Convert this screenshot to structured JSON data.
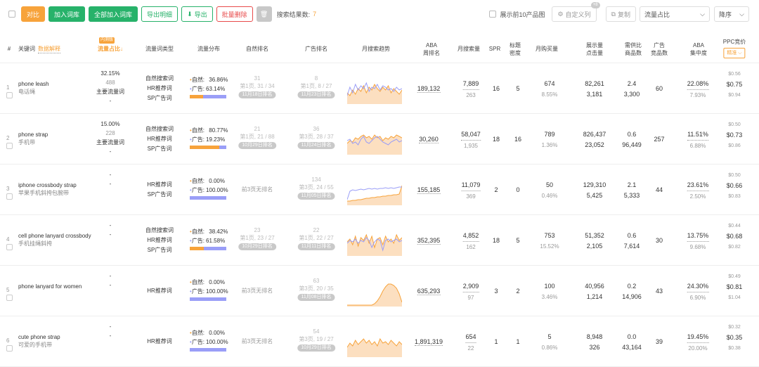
{
  "toolbar": {
    "compare": "对比",
    "add_lib": "加入词库",
    "add_all": "全部加入词库",
    "export_detail": "导出明细",
    "export": "导出",
    "batch_delete": "批量删除",
    "result_label": "搜索结果数:",
    "result_count": "7",
    "show_top10": "展示前10产品图",
    "custom_sense": "自定义列",
    "custom_badge": "+8",
    "copy": "复制",
    "sort_field": "流量占比",
    "sort_order": "降序"
  },
  "headers": {
    "no": "#",
    "keyword": "关键词",
    "keyword_link": "数据解释",
    "new_badge": "内测版",
    "flow_share": "流量占比↓",
    "word_type": "流量词类型",
    "flow_dist": "流量分布",
    "natural_rank": "自然排名",
    "ad_rank": "广告排名",
    "trend": "月搜索趋势",
    "aba_rank_1": "ABA",
    "aba_rank_2": "周排名",
    "monthly_search": "月搜索量",
    "spr": "SPR",
    "title_1": "标题",
    "title_2": "密度",
    "monthly_buy": "月购买量",
    "impr_1": "展示量",
    "impr_2": "点击量",
    "supply_1": "需供比",
    "supply_2": "商品数",
    "ad_1": "广告",
    "ad_2": "竞品数",
    "aba_conc_1": "ABA",
    "aba_conc_2": "集中度",
    "ppc": "PPC竞价",
    "ppc_btn": "精准 ⌵"
  },
  "colors": {
    "orange": "#f7a33b",
    "purple": "#9a9ef7",
    "green": "#27b26a",
    "red": "#e84a4a"
  },
  "rows": [
    {
      "idx": "1",
      "kw": "phone leash",
      "cn": "电话绳",
      "share": "32.15%",
      "share2": "488",
      "share3": "主要流量词",
      "share4": "-",
      "types": [
        "自然搜索词",
        "HR推荐词",
        "SP广告词"
      ],
      "nat_label": "自然:",
      "nat": "36.86%",
      "ad_label": "广告:",
      "ad": "63.14%",
      "nat_frac": 0.37,
      "nrank": "31",
      "nrank2": "第1页, 31 / 34",
      "nrank3": "11月18日排名",
      "arank": "8",
      "arank2": "第1页, 8 / 27",
      "arank3": "11月23日排名",
      "aba": "189,132",
      "search": "7,889",
      "search2": "263",
      "spr": "16",
      "title": "5",
      "buy": "674",
      "buy2": "8.55%",
      "impr": "82,261",
      "impr2": "3,181",
      "sup": "2.4",
      "sup2": "3,300",
      "adc": "60",
      "conc": "22.08%",
      "conc2": "7.93%",
      "ppc1": "$0.56",
      "ppc2": "$0.75",
      "ppc3": "$0.94",
      "s1": [
        14,
        10,
        18,
        12,
        20,
        16,
        24,
        14,
        22,
        18,
        26,
        20,
        16,
        22,
        18,
        24,
        14,
        20,
        16,
        12,
        18
      ],
      "s2": [
        10,
        22,
        14,
        26,
        18,
        24,
        20,
        28,
        16,
        22,
        20,
        26,
        18,
        24,
        22,
        18,
        20,
        16,
        22,
        18,
        20
      ]
    },
    {
      "idx": "2",
      "kw": "phone strap",
      "cn": "手机带",
      "share": "15.00%",
      "share2": "228",
      "share3": "主要流量词",
      "share4": "-",
      "types": [
        "自然搜索词",
        "HR推荐词",
        "SP广告词"
      ],
      "nat_label": "自然:",
      "nat": "80.77%",
      "ad_label": "广告:",
      "ad": "19.23%",
      "nat_frac": 0.81,
      "nrank": "21",
      "nrank2": "第1页, 21 / 88",
      "nrank3": "10月29日排名",
      "arank": "36",
      "arank2": "第3页, 28 / 37",
      "arank3": "11月24日排名",
      "aba": "30,260",
      "search": "58,047",
      "search2": "1,935",
      "spr": "18",
      "title": "16",
      "buy": "789",
      "buy2": "1.36%",
      "impr": "826,437",
      "impr2": "23,052",
      "sup": "0.6",
      "sup2": "96,449",
      "adc": "257",
      "conc": "11.51%",
      "conc2": "6.88%",
      "ppc1": "$0.50",
      "ppc2": "$0.73",
      "ppc3": "$0.86",
      "s1": [
        14,
        18,
        16,
        22,
        20,
        24,
        26,
        22,
        24,
        20,
        26,
        22,
        24,
        18,
        22,
        20,
        24,
        22,
        26,
        24,
        22
      ],
      "s2": [
        18,
        20,
        14,
        16,
        12,
        20,
        24,
        16,
        14,
        18,
        22,
        24,
        20,
        16,
        14,
        12,
        16,
        18,
        20,
        16,
        18
      ]
    },
    {
      "idx": "3",
      "kw": "iphone crossbody strap",
      "cn": "苹果手机斜挎包腕带",
      "share": "-",
      "share2": "",
      "share3": "-",
      "share4": "",
      "types": [
        "HR推荐词",
        "SP广告词"
      ],
      "nat_label": "自然:",
      "nat": "0.00%",
      "ad_label": "广告:",
      "ad": "100.00%",
      "nat_frac": 0,
      "nrank": "",
      "nrank2": "前3页无排名",
      "nrank3": "",
      "arank": "134",
      "arank2": "第3页, 24 / 55",
      "arank3": "11月05日排名",
      "aba": "155,185",
      "search": "11,079",
      "search2": "369",
      "spr": "2",
      "title": "0",
      "buy": "50",
      "buy2": "0.46%",
      "impr": "129,310",
      "impr2": "5,425",
      "sup": "2.1",
      "sup2": "5,333",
      "adc": "44",
      "conc": "23.61%",
      "conc2": "2.50%",
      "ppc1": "$0.50",
      "ppc2": "$0.66",
      "ppc3": "$0.83",
      "s1": [
        4,
        4,
        5,
        5,
        6,
        6,
        7,
        8,
        8,
        9,
        9,
        10,
        10,
        11,
        11,
        12,
        12,
        13,
        13,
        14,
        26
      ],
      "s2": [
        6,
        18,
        20,
        19,
        20,
        21,
        20,
        21,
        22,
        21,
        22,
        21,
        22,
        22,
        23,
        22,
        23,
        22,
        23,
        24,
        24
      ]
    },
    {
      "idx": "4",
      "kw": "cell phone lanyard crossbody",
      "cn": "手机挂绳斜挎",
      "share": "-",
      "share2": "",
      "share3": "-",
      "share4": "",
      "types": [
        "自然搜索词",
        "HR推荐词",
        "SP广告词"
      ],
      "nat_label": "自然:",
      "nat": "38.42%",
      "ad_label": "广告:",
      "ad": "61.58%",
      "nat_frac": 0.38,
      "nrank": "23",
      "nrank2": "第1页, 23 / 27",
      "nrank3": "10月29日排名",
      "arank": "22",
      "arank2": "第1页, 22 / 27",
      "arank3": "11月11日排名",
      "aba": "352,395",
      "search": "4,852",
      "search2": "162",
      "spr": "18",
      "title": "5",
      "buy": "753",
      "buy2": "15.52%",
      "impr": "51,352",
      "impr2": "2,105",
      "sup": "0.6",
      "sup2": "7,614",
      "adc": "30",
      "conc": "13.75%",
      "conc2": "9.68%",
      "ppc1": "$0.44",
      "ppc2": "$0.68",
      "ppc3": "$0.82",
      "s1": [
        18,
        22,
        14,
        26,
        12,
        24,
        20,
        28,
        16,
        26,
        10,
        22,
        24,
        14,
        26,
        18,
        22,
        16,
        28,
        20,
        24
      ],
      "s2": [
        16,
        20,
        18,
        22,
        16,
        20,
        18,
        24,
        20,
        10,
        18,
        22,
        20,
        6,
        20,
        22,
        18,
        20,
        22,
        18,
        20
      ]
    },
    {
      "idx": "5",
      "kw": "phone lanyard for women",
      "cn": "",
      "share": "-",
      "share2": "",
      "share3": "-",
      "share4": "",
      "types": [
        "HR推荐词"
      ],
      "nat_label": "自然:",
      "nat": "0.00%",
      "ad_label": "广告:",
      "ad": "100.00%",
      "nat_frac": 0,
      "nrank": "",
      "nrank2": "前3页无排名",
      "nrank3": "",
      "arank": "63",
      "arank2": "第3页, 20 / 35",
      "arank3": "11月08日排名",
      "aba": "635,293",
      "search": "2,909",
      "search2": "97",
      "spr": "3",
      "title": "2",
      "buy": "100",
      "buy2": "3.46%",
      "impr": "40,956",
      "impr2": "1,214",
      "sup": "0.2",
      "sup2": "14,906",
      "adc": "43",
      "conc": "24.30%",
      "conc2": "6.90%",
      "ppc1": "$0.49",
      "ppc2": "$0.81",
      "ppc3": "$1.04",
      "s1": [
        0,
        0,
        0,
        0,
        0,
        0,
        0,
        0,
        0,
        0,
        2,
        6,
        12,
        20,
        26,
        30,
        30,
        28,
        24,
        16,
        4
      ],
      "s2": []
    },
    {
      "idx": "6",
      "kw": "cute phone strap",
      "cn": "可爱的手机带",
      "share": "-",
      "share2": "",
      "share3": "-",
      "share4": "",
      "types": [
        "HR推荐词"
      ],
      "nat_label": "自然:",
      "nat": "0.00%",
      "ad_label": "广告:",
      "ad": "100.00%",
      "nat_frac": 0,
      "nrank": "",
      "nrank2": "前3页无排名",
      "nrank3": "",
      "arank": "54",
      "arank2": "第3页, 19 / 27",
      "arank3": "10月29日排名",
      "aba": "1,891,319",
      "search": "654",
      "search2": "22",
      "spr": "1",
      "title": "1",
      "buy": "5",
      "buy2": "0.86%",
      "impr": "8,948",
      "impr2": "326",
      "sup": "0.0",
      "sup2": "43,164",
      "adc": "39",
      "conc": "19.45%",
      "conc2": "20.00%",
      "ppc1": "$0.32",
      "ppc2": "$0.35",
      "ppc3": "$0.38",
      "s1": [
        12,
        18,
        14,
        22,
        16,
        20,
        24,
        18,
        22,
        16,
        20,
        14,
        24,
        18,
        20,
        16,
        22,
        18,
        14,
        20,
        16
      ],
      "s2": []
    }
  ]
}
